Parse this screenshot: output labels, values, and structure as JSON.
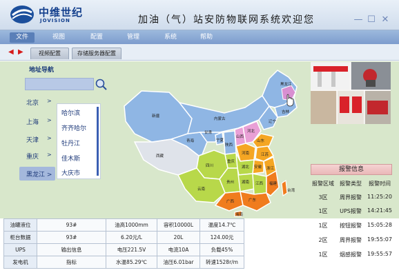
{
  "header": {
    "brand": "中维世纪",
    "brand_sub": "JOVISION",
    "title": "加油（气）站安防物联网系统欢迎您"
  },
  "menu": [
    "文件",
    "视图",
    "配置",
    "管理",
    "系统",
    "帮助"
  ],
  "tabs": [
    "视频配置",
    "存储服务器配置"
  ],
  "nav": {
    "title": "地址导航",
    "search_placeholder": "",
    "provinces": [
      "北京",
      "上海",
      "天津",
      "重庆",
      "黑龙江"
    ],
    "chevron": ">",
    "cities": [
      "哈尔滨",
      "齐齐哈尔",
      "牡丹江",
      "佳木斯",
      "大庆市"
    ]
  },
  "map": {
    "labels": [
      "黑龙江",
      "吉林",
      "辽宁",
      "内蒙古",
      "新疆",
      "西藏",
      "青海",
      "甘肃",
      "宁夏",
      "山西",
      "河北",
      "山东",
      "河南",
      "陕西",
      "四川",
      "重庆",
      "湖北",
      "安徽",
      "江苏",
      "浙江",
      "江西",
      "湖南",
      "贵州",
      "云南",
      "广西",
      "广东",
      "福建",
      "台湾",
      "海南"
    ]
  },
  "alarm": {
    "title": "报警信息",
    "columns": [
      "报警区域",
      "报警类型",
      "报警时间"
    ],
    "rows": [
      [
        "3区",
        "周界报警",
        "11:25:20"
      ],
      [
        "1区",
        "UPS报警",
        "14:21:45"
      ],
      [
        "1区",
        "按钮报警",
        "15:05:28"
      ],
      [
        "2区",
        "周界报警",
        "19:55:07"
      ],
      [
        "1区",
        "烟感报警",
        "19:55:57"
      ]
    ]
  },
  "table": {
    "rows": [
      [
        "油罐液位",
        "93#",
        "油高1000mm",
        "容积10000L",
        "温度14.7℃"
      ],
      [
        "柜台数据",
        "93#",
        "6.20元/L",
        "20L",
        "124.00元"
      ],
      [
        "UPS",
        "输出信息",
        "电压221.5V",
        "电流10A",
        "负载45%"
      ],
      [
        "发电机",
        "指标",
        "水温85.29℃",
        "油压6.01bar",
        "转速1528r/m"
      ]
    ]
  },
  "colors": {
    "menubar": "#8aa9d6",
    "main_bg": "#d8e7cb",
    "map_north": "#8fb6e4",
    "map_west": "#dfe3ea",
    "map_south": "#f07c1e",
    "map_central": "#b8d84a",
    "alarm_head": "#eab8b8"
  },
  "icons": [
    "jovision-logo",
    "minimize-icon",
    "maximize-icon",
    "close-icon",
    "left-arrow-icon",
    "right-arrow-icon",
    "search-icon",
    "hand-cursor-icon"
  ]
}
